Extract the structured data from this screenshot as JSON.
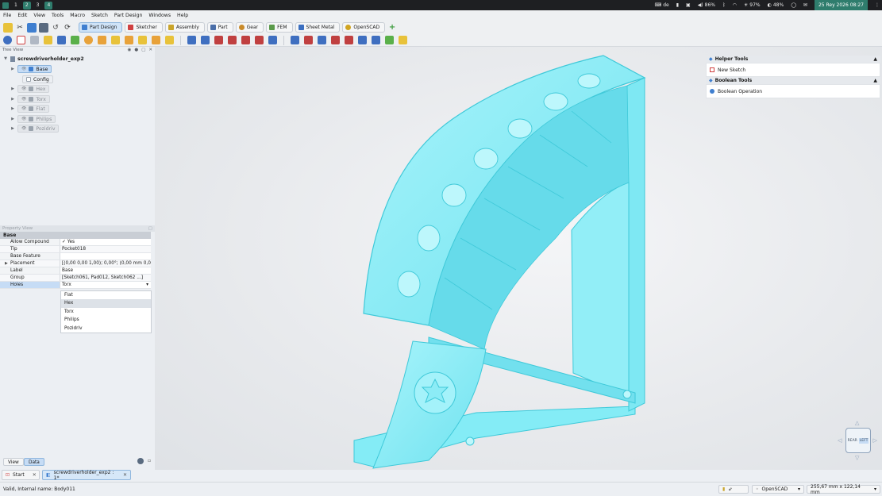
{
  "sysbar": {
    "workspaces": [
      "1",
      "2",
      "3",
      "4"
    ],
    "keyboard": "de",
    "volume": "86%",
    "brightness": "97%",
    "battery": "48%",
    "clock": "25 Rey 2026 08:27"
  },
  "menu": [
    "File",
    "Edit",
    "View",
    "Tools",
    "Macro",
    "Sketch",
    "Part Design",
    "Windows",
    "Help"
  ],
  "workbenches": [
    {
      "label": "Part Design",
      "color": "#3f7fd0"
    },
    {
      "label": "Sketcher",
      "color": "#d04040"
    },
    {
      "label": "Assembly",
      "color": "#c9a42a"
    },
    {
      "label": "Part",
      "color": "#4a6ea8"
    },
    {
      "label": "Gear",
      "color": "#c98a2a"
    },
    {
      "label": "FEM",
      "color": "#5a9a4a"
    },
    {
      "label": "Sheet Metal",
      "color": "#3a6ec0"
    },
    {
      "label": "OpenSCAD",
      "color": "#d0a420"
    }
  ],
  "tree": {
    "header": "Tree View",
    "document": "screwdriverholder_exp2",
    "items": [
      "Base",
      "Config",
      "Hex",
      "Torx",
      "Flat",
      "Philips",
      "Pozidriv"
    ]
  },
  "property": {
    "header": "Property View",
    "group": "Base",
    "rows": [
      {
        "key": "Allow Compound",
        "value": "✓  Yes"
      },
      {
        "key": "Tip",
        "value": "Pocket018"
      },
      {
        "key": "Base Feature",
        "value": ""
      },
      {
        "key": "Placement",
        "value": "[(0,00 0,00 1,00); 0,00°; (0,00 mm  0,0..."
      },
      {
        "key": "Label",
        "value": "Base"
      },
      {
        "key": "Group",
        "value": "[Sketch061, Pad012, Sketch062 ...]"
      },
      {
        "key": "Holes",
        "value": "Torx"
      }
    ],
    "dropdown": [
      "Flat",
      "Hex",
      "Torx",
      "Philips",
      "Pozidriv"
    ]
  },
  "bottom_tabs": {
    "view": "View",
    "data": "Data"
  },
  "task_panel": {
    "helper_title": "Helper Tools",
    "new_sketch": "New Sketch",
    "boolean_title": "Boolean Tools",
    "boolean_op": "Boolean Operation"
  },
  "doc_tabs": {
    "start": "Start",
    "doc": "screwdriverholder_exp2 : 1*"
  },
  "status": {
    "message": "Valid, Internal name: Body011",
    "nav_style": "OpenSCAD",
    "dimensions": "255,67 mm x 122,14 mm"
  },
  "navcube": {
    "face_front": "REAR",
    "face_side": "LEFT"
  },
  "colors": {
    "model": "#7eeaf5",
    "model_edge": "#3fc9d9",
    "accent": "#2f7d6d"
  }
}
